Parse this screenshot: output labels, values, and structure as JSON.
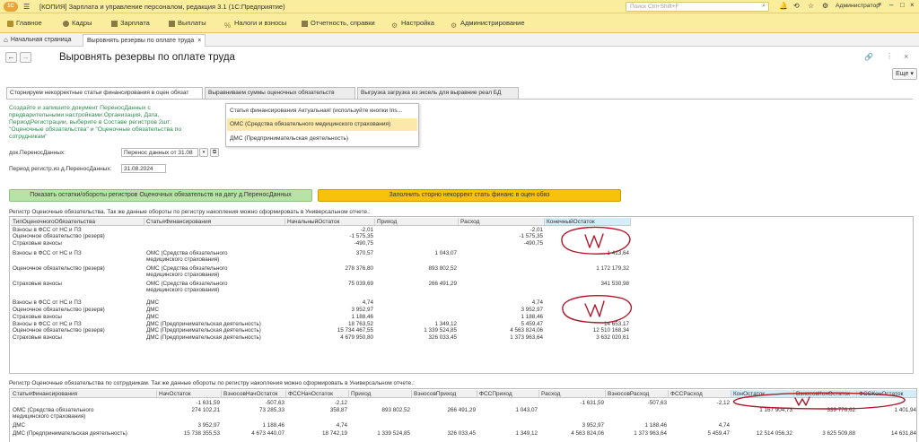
{
  "window": {
    "title": "[КОПИЯ] Зарплата и управление персоналом, редакция 3.1  (1С:Предприятие)",
    "search_placeholder": "Поиск Ctrl+Shift+F",
    "user": "Администратор"
  },
  "menu": [
    "Главное",
    "Кадры",
    "Зарплата",
    "Выплаты",
    "Налоги и взносы",
    "Отчетность, справки",
    "Настройка",
    "Администрирование"
  ],
  "tabs_top": {
    "home": "Начальная страница",
    "doc": "Выровнять резервы по оплате труда"
  },
  "page": {
    "title": "Выровнять резервы по оплате труда",
    "more": "Еще"
  },
  "subtabs": [
    "Сторнируем некорректные статьи финансирования в оцен обязат",
    "Выравниваем суммы оценочных обязательств",
    "Выгрузка загрузка из эксель для выравние реал БД"
  ],
  "instructions": "Создайте и запишите документ ПереносДанных с\nпредварительными настройками:Организация, Дата,\nПериодРегистрации, выберите в Составе регистров 2шт:\n\"Оценочные обязательства\" и \"Оценочные обязательства по\nсотрудникам\"",
  "fields": {
    "doc_label": "док.ПереносДанных:",
    "doc_value": "Перенос данных  от 31.08",
    "period_label": "Период регистр.из д.ПереносДанных:",
    "period_value": "31.08.2024"
  },
  "popup": {
    "header": "Статья финансирования Актуальная! (используйте кнопки Ins...",
    "items": [
      "ОМС (Средства обязательного медицинского страхования)",
      "ДМС (Предпринимательская деятельность)"
    ]
  },
  "buttons": {
    "show": "Показать остатки/обороты регистров Оценочных обязательств на дату д.ПереносДанных",
    "fill": "Заполнить сторно некоррект стать финанс в оцен обяз"
  },
  "section1": {
    "caption": "Регистр Оценочные обязательства. Так же данные обороты по регистру накопления можно сформировать в Универсальном отчете.:",
    "columns": [
      "ТипОценочногоОбязательства",
      "СтатьяФинансирования",
      "НачальныйОстаток",
      "Приход",
      "Расход",
      "КонечныйОстаток"
    ],
    "rows": [
      [
        "Взносы в ФСС от НС и ПЗ",
        "",
        "-2,01",
        "",
        "-2,01",
        ""
      ],
      [
        "Оценочное обязательство (резерв)",
        "",
        "-1 575,35",
        "",
        "-1 575,35",
        ""
      ],
      [
        "Страховые взносы",
        "",
        "-490,75",
        "",
        "-490,75",
        ""
      ],
      [
        "Взносы в ФСС от НС и ПЗ",
        "ОМС (Средства обязательного\nмедицинского страхования)",
        "370,57",
        "1 043,07",
        "",
        "1 413,64"
      ],
      [
        "Оценочное обязательство (резерв)",
        "ОМС (Средства обязательного\nмедицинского страхования)",
        "278 376,80",
        "893 802,52",
        "",
        "1 172 179,32"
      ],
      [
        "Страховые взносы",
        "ОМС (Средства обязательного\nмедицинского страхования)",
        "75 039,69",
        "266 491,29",
        "",
        "341 530,98"
      ],
      [
        "Взносы в ФСС от НС и ПЗ",
        "ДМС",
        "4,74",
        "",
        "4,74",
        ""
      ],
      [
        "Оценочное обязательство (резерв)",
        "ДМС",
        "3 952,97",
        "",
        "3 952,97",
        ""
      ],
      [
        "Страховые взносы",
        "ДМС",
        "1 188,46",
        "",
        "1 188,46",
        ""
      ],
      [
        "Взносы в ФСС от НС и ПЗ",
        "ДМС (Предпринимательская деятельность)",
        "18 763,52",
        "1 349,12",
        "5 459,47",
        "14 653,17"
      ],
      [
        "Оценочное обязательство (резерв)",
        "ДМС (Предпринимательская деятельность)",
        "15 734 467,55",
        "1 339 524,85",
        "4 563 824,06",
        "12 510 168,34"
      ],
      [
        "Страховые взносы",
        "ДМС (Предпринимательская деятельность)",
        "4 679 950,80",
        "326 033,45",
        "1 373 963,64",
        "3 632 020,61"
      ]
    ]
  },
  "section2": {
    "caption": "Регистр Оценочные обязательства по сотрудникам. Так же данные обороты по регистру накопления можно сформировать в Универсальном отчете.:",
    "columns": [
      "СтатьяФинансирования",
      "НачОстаток",
      "ВзносовНачОстаток",
      "ФССНачОстаток",
      "Приход",
      "ВзносовПриход",
      "ФССПриход",
      "Расход",
      "ВзносовРасход",
      "ФССРасход",
      "КонОстаток",
      "ВзносовКонОстаток",
      "ФССКонОстаток"
    ],
    "rows": [
      [
        "",
        "-1 631,59",
        "-507,63",
        "-2,12",
        "",
        "",
        "",
        "-1 631,59",
        "-507,63",
        "-2,12",
        "",
        "",
        ""
      ],
      [
        "ОМС (Средства обязательного\nмедицинского страхования)",
        "274 102,21",
        "73 285,33",
        "358,87",
        "893 802,52",
        "266 491,29",
        "1 043,07",
        "",
        "",
        "",
        "1 167 904,73",
        "339 776,62",
        "1 401,94"
      ],
      [
        "ДМС",
        "3 952,97",
        "1 188,46",
        "4,74",
        "",
        "",
        "",
        "3 952,97",
        "1 188,46",
        "4,74",
        "",
        "",
        ""
      ],
      [
        "ДМС (Предпринимательская деятельность)",
        "15 738 355,53",
        "4 673 440,07",
        "18 742,19",
        "1 339 524,85",
        "326 033,45",
        "1 349,12",
        "4 563 824,06",
        "1 373 963,64",
        "5 459,47",
        "12 514 056,32",
        "3 625 509,88",
        "14 631,84"
      ]
    ]
  },
  "colors": {
    "header_yellow": "#fbed9e",
    "button_green": "#b8e3a6",
    "button_orange": "#f7c10c",
    "highlight_blue": "#d3eef8",
    "annotation_red": "#b0182c"
  }
}
